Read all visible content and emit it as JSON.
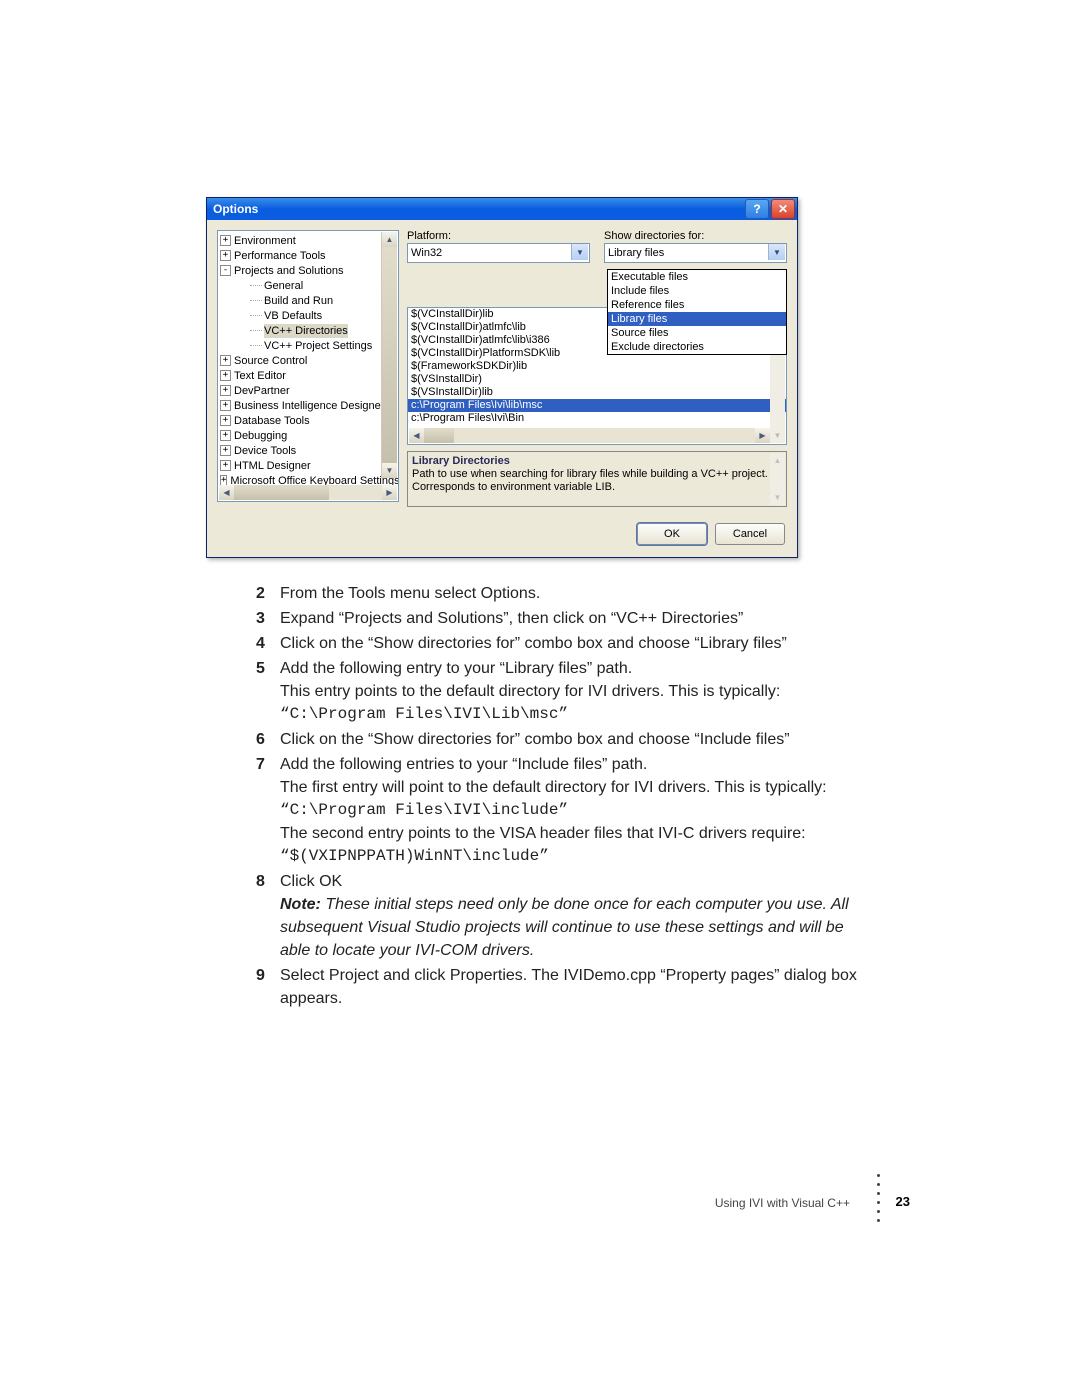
{
  "dialog": {
    "title": "Options",
    "tree": [
      {
        "expand": "+",
        "indent": 0,
        "label": "Environment"
      },
      {
        "expand": "+",
        "indent": 0,
        "label": "Performance Tools"
      },
      {
        "expand": "-",
        "indent": 0,
        "label": "Projects and Solutions"
      },
      {
        "expand": "",
        "indent": 2,
        "label": "General"
      },
      {
        "expand": "",
        "indent": 2,
        "label": "Build and Run"
      },
      {
        "expand": "",
        "indent": 2,
        "label": "VB Defaults"
      },
      {
        "expand": "",
        "indent": 2,
        "label": "VC++ Directories",
        "selected": true
      },
      {
        "expand": "",
        "indent": 2,
        "label": "VC++ Project Settings"
      },
      {
        "expand": "+",
        "indent": 0,
        "label": "Source Control"
      },
      {
        "expand": "+",
        "indent": 0,
        "label": "Text Editor"
      },
      {
        "expand": "+",
        "indent": 0,
        "label": "DevPartner"
      },
      {
        "expand": "+",
        "indent": 0,
        "label": "Business Intelligence Designers"
      },
      {
        "expand": "+",
        "indent": 0,
        "label": "Database Tools"
      },
      {
        "expand": "+",
        "indent": 0,
        "label": "Debugging"
      },
      {
        "expand": "+",
        "indent": 0,
        "label": "Device Tools"
      },
      {
        "expand": "+",
        "indent": 0,
        "label": "HTML Designer"
      },
      {
        "expand": "+",
        "indent": 0,
        "label": "Microsoft Office Keyboard Settings"
      }
    ],
    "platform_label": "Platform:",
    "platform_value": "Win32",
    "showdirs_label": "Show directories for:",
    "showdirs_value": "Library files",
    "showdirs_options": [
      {
        "label": "Executable files"
      },
      {
        "label": "Include files"
      },
      {
        "label": "Reference files"
      },
      {
        "label": "Library files",
        "selected": true
      },
      {
        "label": "Source files"
      },
      {
        "label": "Exclude directories"
      }
    ],
    "dir_entries": [
      "$(VCInstallDir)lib",
      "$(VCInstallDir)atlmfc\\lib",
      "$(VCInstallDir)atlmfc\\lib\\i386",
      "$(VCInstallDir)PlatformSDK\\lib",
      "$(FrameworkSDKDir)lib",
      "$(VSInstallDir)",
      "$(VSInstallDir)lib",
      "c:\\Program Files\\Ivi\\lib\\msc",
      "c:\\Program Files\\Ivi\\Bin"
    ],
    "dir_selected_index": 7,
    "desc_title": "Library Directories",
    "desc_body": "Path to use when searching for library files while building a VC++ project. Corresponds to environment variable LIB.",
    "ok_label": "OK",
    "cancel_label": "Cancel"
  },
  "steps": [
    {
      "n": "2",
      "lines": [
        "From the Tools menu select Options."
      ]
    },
    {
      "n": "3",
      "lines": [
        "Expand “Projects and Solutions”, then click on “VC++ Directories”"
      ]
    },
    {
      "n": "4",
      "lines": [
        "Click on the “Show directories for” combo box and choose “Library files”"
      ]
    },
    {
      "n": "5",
      "lines": [
        "Add the following entry to your “Library files” path.",
        "This entry points to the default directory for IVI drivers. This is typically:",
        {
          "code": "“C:\\Program Files\\IVI\\Lib\\msc”"
        }
      ]
    },
    {
      "n": "6",
      "lines": [
        "Click on the “Show directories for” combo box and choose “Include files”"
      ]
    },
    {
      "n": "7",
      "lines": [
        "Add the following entries to your “Include files” path.",
        "The first entry will point to the default directory for IVI drivers. This is typically:",
        {
          "code": "“C:\\Program Files\\IVI\\include”"
        },
        "The second entry points to the VISA header files that IVI-C drivers require:",
        {
          "code": "“$(VXIPNPPATH)WinNT\\include”"
        }
      ]
    },
    {
      "n": "8",
      "lines": [
        "Click OK",
        {
          "note": "Note: These initial steps need only be done once for each computer you use. All subsequent Visual Studio projects will continue to use these settings and will be able to locate your IVI-COM drivers."
        }
      ]
    },
    {
      "n": "9",
      "lines": [
        "Select Project and click Properties. The IVIDemo.cpp “Property pages” dialog box appears."
      ]
    }
  ],
  "footer": {
    "text": "Using IVI with Visual C++",
    "page": "23"
  }
}
